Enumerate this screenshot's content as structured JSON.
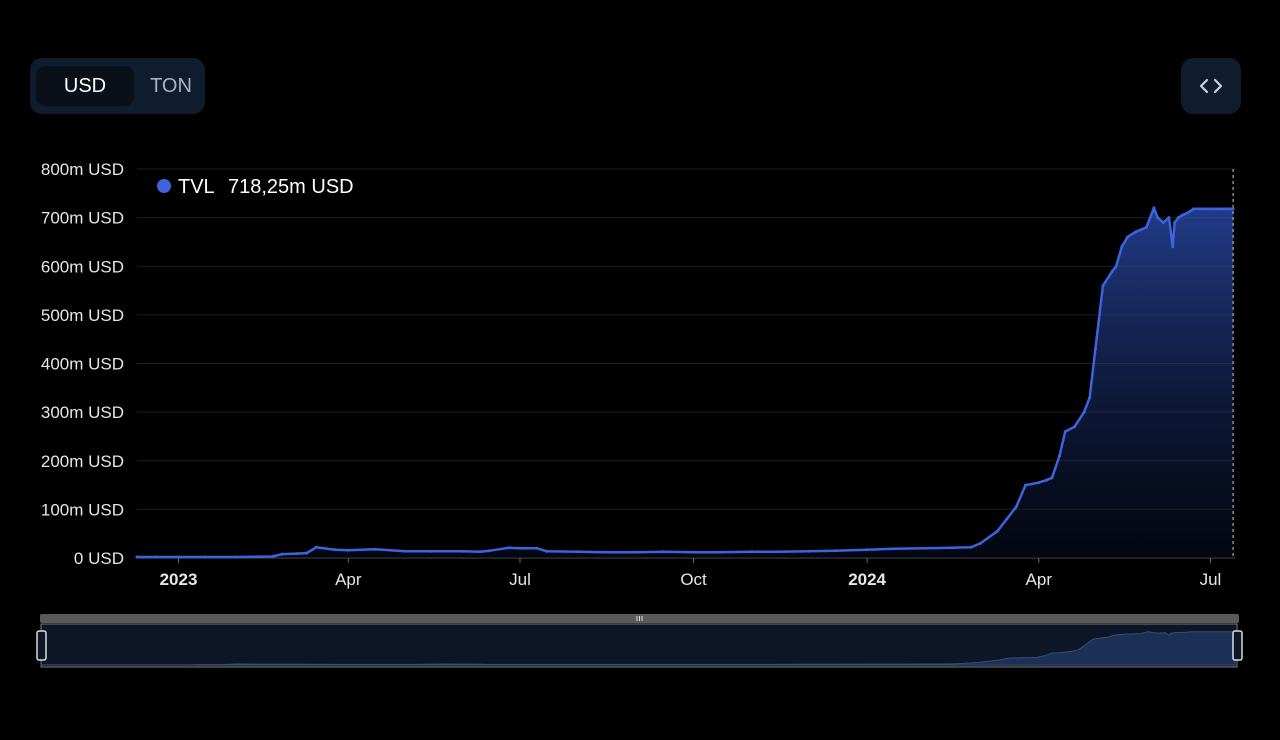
{
  "currency_toggle": {
    "options": [
      "USD",
      "TON"
    ],
    "selected": "USD"
  },
  "embed_icon": "code-brackets-icon",
  "colors": {
    "series": "#3d63dd",
    "panel": "#0f1c2e",
    "background": "#000000"
  },
  "chart_data": {
    "type": "area",
    "title": "",
    "xlabel": "",
    "ylabel": "",
    "ylim": [
      0,
      800
    ],
    "y_unit": "m USD",
    "y_ticks": [
      "0 USD",
      "100m USD",
      "200m USD",
      "300m USD",
      "400m USD",
      "500m USD",
      "600m USD",
      "700m USD",
      "800m USD"
    ],
    "x_ticks": [
      {
        "label": "2023",
        "date": "2023-01-01",
        "bold": true
      },
      {
        "label": "Apr",
        "date": "2023-04-01",
        "bold": false
      },
      {
        "label": "Jul",
        "date": "2023-07-01",
        "bold": false
      },
      {
        "label": "Oct",
        "date": "2023-10-01",
        "bold": false
      },
      {
        "label": "2024",
        "date": "2024-01-01",
        "bold": true
      },
      {
        "label": "Apr",
        "date": "2024-04-01",
        "bold": false
      },
      {
        "label": "Jul",
        "date": "2024-07-01",
        "bold": false
      }
    ],
    "grid": true,
    "legend": {
      "position": "top-left",
      "series_label": "TVL",
      "value_label": "718,25m USD"
    },
    "series": [
      {
        "name": "TVL",
        "x": [
          "2022-12-10",
          "2022-12-20",
          "2023-01-01",
          "2023-01-15",
          "2023-02-01",
          "2023-02-20",
          "2023-02-25",
          "2023-03-05",
          "2023-03-10",
          "2023-03-15",
          "2023-03-25",
          "2023-04-01",
          "2023-04-15",
          "2023-05-01",
          "2023-05-15",
          "2023-06-01",
          "2023-06-10",
          "2023-06-15",
          "2023-06-25",
          "2023-07-01",
          "2023-07-10",
          "2023-07-15",
          "2023-08-01",
          "2023-08-15",
          "2023-09-01",
          "2023-09-15",
          "2023-10-01",
          "2023-10-15",
          "2023-11-01",
          "2023-11-15",
          "2023-12-01",
          "2023-12-15",
          "2024-01-01",
          "2024-01-15",
          "2024-02-01",
          "2024-02-15",
          "2024-02-25",
          "2024-03-01",
          "2024-03-10",
          "2024-03-15",
          "2024-03-20",
          "2024-03-25",
          "2024-04-01",
          "2024-04-05",
          "2024-04-08",
          "2024-04-12",
          "2024-04-15",
          "2024-04-20",
          "2024-04-25",
          "2024-04-28",
          "2024-05-01",
          "2024-05-05",
          "2024-05-10",
          "2024-05-12",
          "2024-05-15",
          "2024-05-18",
          "2024-05-22",
          "2024-05-28",
          "2024-06-01",
          "2024-06-03",
          "2024-06-06",
          "2024-06-09",
          "2024-06-11",
          "2024-06-12",
          "2024-06-14",
          "2024-06-16",
          "2024-06-19",
          "2024-06-22",
          "2024-06-25",
          "2024-06-27",
          "2024-06-29",
          "2024-07-01",
          "2024-07-03",
          "2024-07-05",
          "2024-07-07",
          "2024-07-09",
          "2024-07-11",
          "2024-07-13"
        ],
        "values": [
          2,
          2,
          2,
          2,
          2,
          3,
          8,
          9,
          10,
          22,
          17,
          16,
          18,
          14,
          14,
          14,
          13,
          15,
          21,
          20,
          20,
          14,
          13,
          12,
          12,
          13,
          12,
          12,
          13,
          13,
          14,
          15,
          17,
          19,
          20,
          21,
          22,
          30,
          55,
          80,
          105,
          150,
          155,
          160,
          165,
          210,
          260,
          270,
          300,
          330,
          430,
          560,
          590,
          600,
          640,
          660,
          670,
          680,
          720,
          700,
          690,
          700,
          640,
          690,
          700,
          705,
          710,
          718,
          718,
          718,
          718,
          718,
          718,
          718,
          718,
          718,
          718,
          718
        ]
      }
    ]
  }
}
